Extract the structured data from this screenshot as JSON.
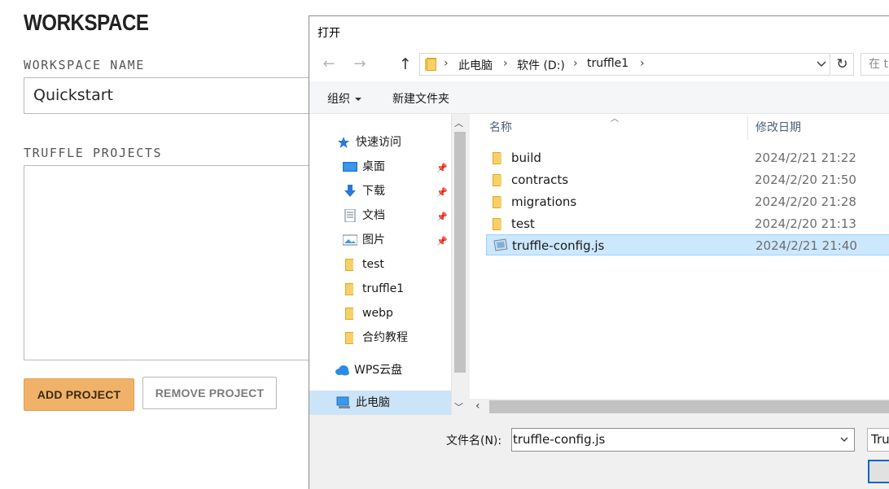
{
  "workspace": {
    "title": "WORKSPACE",
    "name_label": "WORKSPACE NAME",
    "name_value": "Quickstart",
    "projects_label": "TRUFFLE PROJECTS",
    "add_button": "ADD PROJECT",
    "remove_button": "REMOVE PROJECT"
  },
  "dialog": {
    "title": "打开",
    "breadcrumb": [
      "此电脑",
      "软件 (D:)",
      "truffle1"
    ],
    "search_placeholder": "在 t",
    "toolbar": {
      "organize": "组织",
      "new_folder": "新建文件夹"
    },
    "nav": {
      "quick_access": "快速访问",
      "items": [
        {
          "label": "桌面",
          "icon": "desktop-icon",
          "pinned": true
        },
        {
          "label": "下载",
          "icon": "download-icon",
          "pinned": true
        },
        {
          "label": "文档",
          "icon": "document-icon",
          "pinned": true
        },
        {
          "label": "图片",
          "icon": "pictures-icon",
          "pinned": true
        },
        {
          "label": "test",
          "icon": "folder-icon",
          "pinned": false
        },
        {
          "label": "truffle1",
          "icon": "folder-icon",
          "pinned": false
        },
        {
          "label": "webp",
          "icon": "folder-icon",
          "pinned": false
        },
        {
          "label": "合约教程",
          "icon": "folder-icon",
          "pinned": false
        }
      ],
      "wps": "WPS云盘",
      "this_pc": "此电脑"
    },
    "columns": {
      "name": "名称",
      "modified": "修改日期"
    },
    "files": [
      {
        "name": "build",
        "date": "2024/2/21 21:22",
        "type": "folder",
        "selected": false
      },
      {
        "name": "contracts",
        "date": "2024/2/20 21:50",
        "type": "folder",
        "selected": false
      },
      {
        "name": "migrations",
        "date": "2024/2/20 21:28",
        "type": "folder",
        "selected": false
      },
      {
        "name": "test",
        "date": "2024/2/20 21:13",
        "type": "folder",
        "selected": false
      },
      {
        "name": "truffle-config.js",
        "date": "2024/2/21 21:40",
        "type": "js",
        "selected": true
      }
    ],
    "filename_label": "文件名(N):",
    "filename_value": "truffle-config.js",
    "filetype_value": "Tru"
  },
  "colors": {
    "accent_orange": "#f0b269",
    "selection_blue": "#cce8ff",
    "folder_yellow": "#f5c542"
  }
}
